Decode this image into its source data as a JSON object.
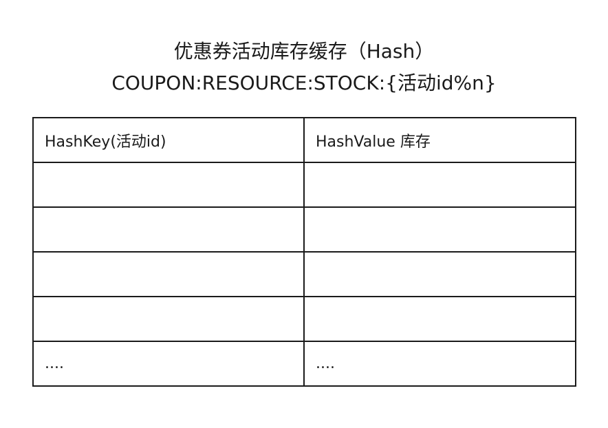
{
  "title": {
    "line1": "优惠券活动库存缓存（Hash）",
    "line2": "COUPON:RESOURCE:STOCK:{活动id%n}"
  },
  "table": {
    "headers": [
      "HashKey(活动id)",
      "HashValue 库存"
    ],
    "rows": [
      [
        "",
        ""
      ],
      [
        "",
        ""
      ],
      [
        "",
        ""
      ],
      [
        "",
        ""
      ],
      [
        "....",
        "...."
      ]
    ]
  }
}
